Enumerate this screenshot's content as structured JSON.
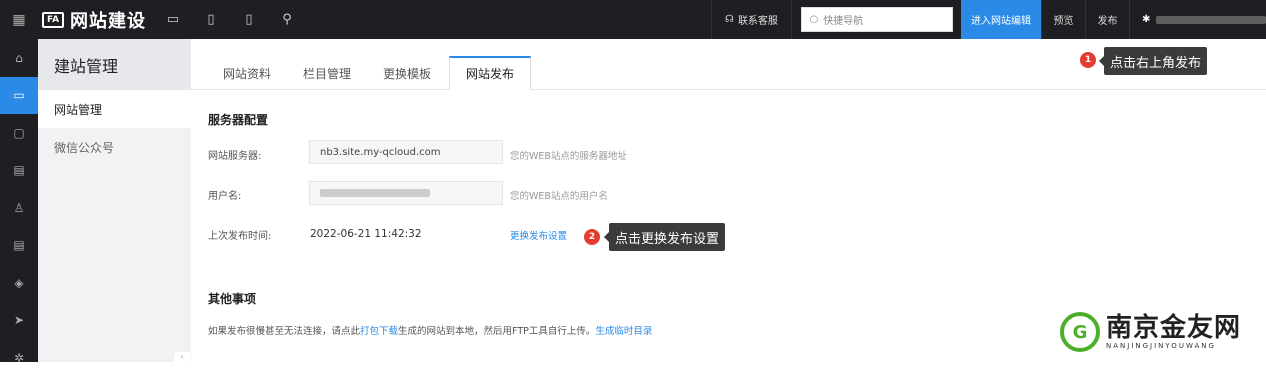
{
  "topbar": {
    "logo_icon": "FA",
    "logo_text": "网站建设",
    "devices": [
      "desktop-icon",
      "tablet-icon",
      "mobile-icon",
      "link-icon"
    ],
    "support_label": "联系客服",
    "search_placeholder": "快捷导航",
    "enter_editor_label": "进入网站编辑",
    "preview_label": "预览",
    "publish_label": "发布"
  },
  "rail": {
    "items": [
      "home-icon",
      "site-icon",
      "shop-icon",
      "gift-icon",
      "user-icon",
      "doc-icon",
      "box-icon",
      "send-icon",
      "settings-icon"
    ]
  },
  "subnav": {
    "title": "建站管理",
    "items": [
      {
        "label": "网站管理",
        "active": true
      },
      {
        "label": "微信公众号",
        "active": false
      }
    ]
  },
  "tabs": [
    {
      "label": "网站资料",
      "active": false
    },
    {
      "label": "栏目管理",
      "active": false
    },
    {
      "label": "更换模板",
      "active": false
    },
    {
      "label": "网站发布",
      "active": true
    }
  ],
  "server": {
    "section_title": "服务器配置",
    "server_label": "网站服务器:",
    "server_value": "nb3.site.my-qcloud.com",
    "server_hint": "您的WEB站点的服务器地址",
    "username_label": "用户名:",
    "username_hint": "您的WEB站点的用户名",
    "last_publish_label": "上次发布时间:",
    "last_publish_value": "2022-06-21 11:42:32",
    "change_settings_link": "更换发布设置"
  },
  "other": {
    "section_title": "其他事项",
    "note_prefix": "如果发布很慢甚至无法连接，请点此",
    "note_link1": "打包下载",
    "note_middle": "生成的网站到本地，然后用FTP工具自行上传。",
    "note_link2": "生成临时目录"
  },
  "callouts": [
    {
      "number": "1",
      "text": "点击右上角发布"
    },
    {
      "number": "2",
      "text": "点击更换发布设置"
    }
  ],
  "watermark": {
    "logo_letter": "G",
    "cn": "南京金友网",
    "en": "NANJINGJINYOUWANG"
  },
  "colors": {
    "accent": "#2a8ae6",
    "topbar_bg": "#1e1f22",
    "badge": "#e43d30",
    "watermark_green": "#4caf2a"
  }
}
